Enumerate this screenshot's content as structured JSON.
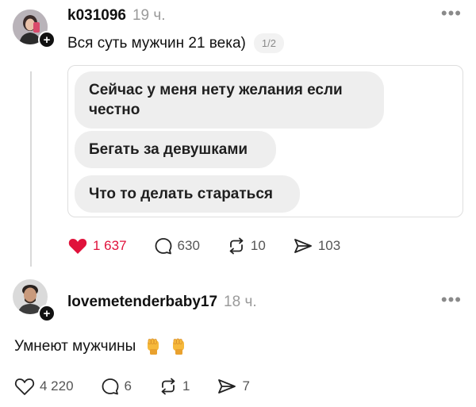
{
  "posts": [
    {
      "username": "k031096",
      "time": "19 ч.",
      "caption": "Вся суть мужчин 21 века)",
      "page_indicator": "1/2",
      "messages": [
        "Сейчас у меня нету желания если честно",
        "Бегать за девушками",
        "Что то делать стараться"
      ],
      "likes": "1 637",
      "comments": "630",
      "reposts": "10",
      "shares": "103",
      "liked": true,
      "more_icon": "•••"
    },
    {
      "username": "lovemetenderbaby17",
      "time": "18 ч.",
      "text": "Умнеют мужчины",
      "emojis": [
        "raised-fist-emoji",
        "raised-fist-emoji"
      ],
      "likes": "4 220",
      "comments": "6",
      "reposts": "1",
      "shares": "7",
      "liked": false,
      "more_icon": "•••"
    }
  ],
  "follow_icon": "+",
  "colors": {
    "like_red": "#e0123b",
    "muted": "#9a9a9a",
    "bubble_bg": "#eeeeee",
    "card_border": "#dedede"
  },
  "icons": [
    "heart-icon",
    "comment-icon",
    "repost-icon",
    "share-icon",
    "more-icon",
    "plus-icon"
  ]
}
